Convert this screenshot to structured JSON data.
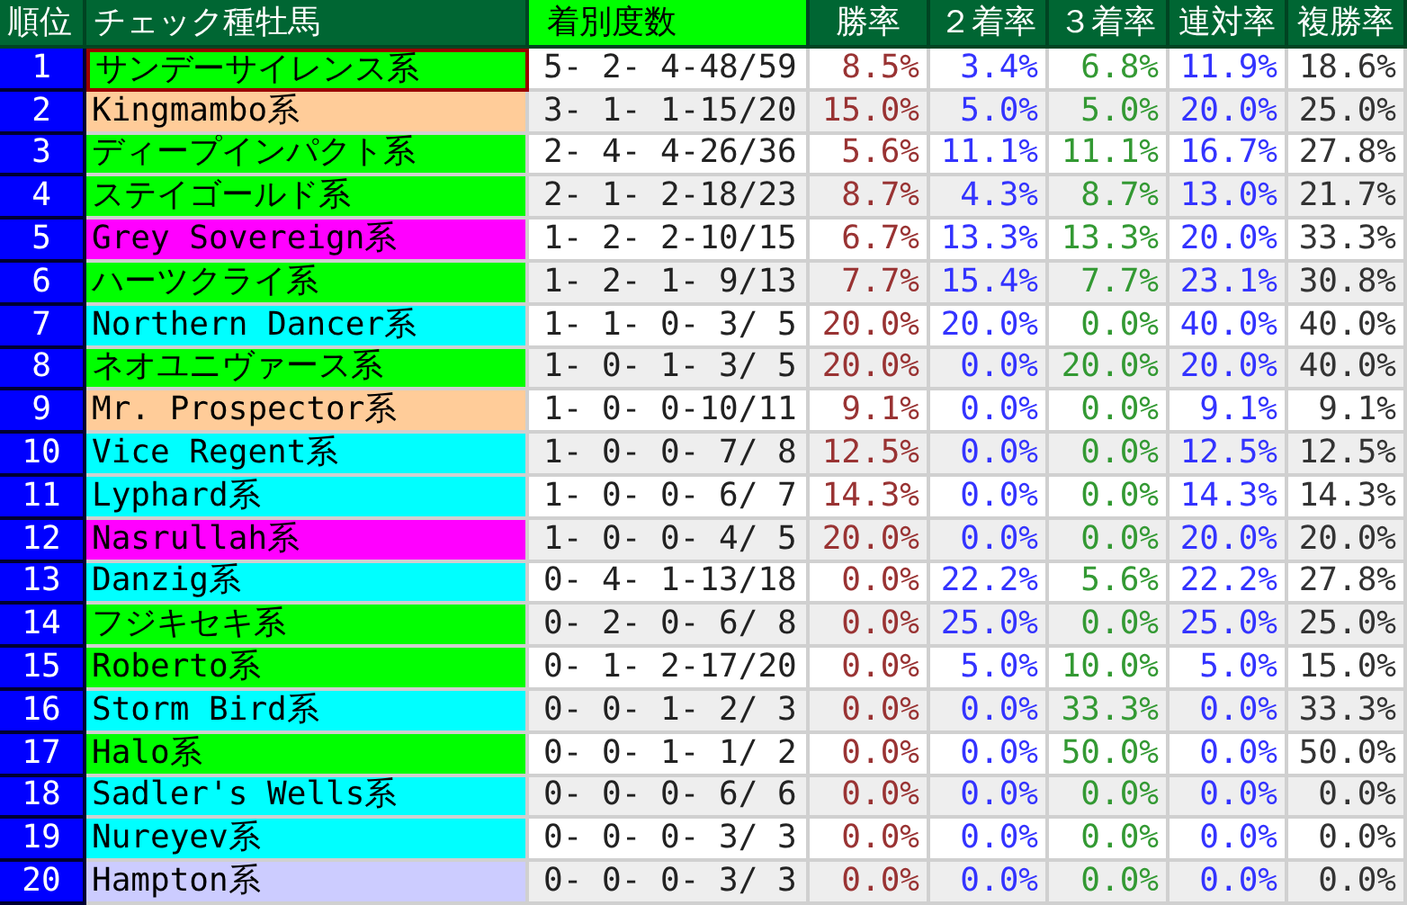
{
  "table": {
    "columns": [
      {
        "label": "順位",
        "selected": false
      },
      {
        "label": "チェック種牡馬",
        "selected": false
      },
      {
        "label": "着別度数",
        "selected": true
      },
      {
        "label": "勝率",
        "selected": false
      },
      {
        "label": "２着率",
        "selected": false
      },
      {
        "label": "３着率",
        "selected": false
      },
      {
        "label": "連対率",
        "selected": false
      },
      {
        "label": "複勝率",
        "selected": false
      }
    ],
    "rows": [
      {
        "rank": "1",
        "name": "サンデーサイレンス系",
        "color": "#00ff00",
        "selected": true,
        "record": "5- 2- 4-48/59",
        "win": "8.5%",
        "second": "3.4%",
        "third": "6.8%",
        "rentai": "11.9%",
        "fukusho": "18.6%"
      },
      {
        "rank": "2",
        "name": "Kingmambo系",
        "color": "#ffcc99",
        "selected": false,
        "record": "3- 1- 1-15/20",
        "win": "15.0%",
        "second": "5.0%",
        "third": "5.0%",
        "rentai": "20.0%",
        "fukusho": "25.0%"
      },
      {
        "rank": "3",
        "name": "ディープインパクト系",
        "color": "#00ff00",
        "selected": false,
        "record": "2- 4- 4-26/36",
        "win": "5.6%",
        "second": "11.1%",
        "third": "11.1%",
        "rentai": "16.7%",
        "fukusho": "27.8%"
      },
      {
        "rank": "4",
        "name": "ステイゴールド系",
        "color": "#00ff00",
        "selected": false,
        "record": "2- 1- 2-18/23",
        "win": "8.7%",
        "second": "4.3%",
        "third": "8.7%",
        "rentai": "13.0%",
        "fukusho": "21.7%"
      },
      {
        "rank": "5",
        "name": "Grey Sovereign系",
        "color": "#ff00ff",
        "selected": false,
        "record": "1- 2- 2-10/15",
        "win": "6.7%",
        "second": "13.3%",
        "third": "13.3%",
        "rentai": "20.0%",
        "fukusho": "33.3%"
      },
      {
        "rank": "6",
        "name": "ハーツクライ系",
        "color": "#00ff00",
        "selected": false,
        "record": "1- 2- 1- 9/13",
        "win": "7.7%",
        "second": "15.4%",
        "third": "7.7%",
        "rentai": "23.1%",
        "fukusho": "30.8%"
      },
      {
        "rank": "7",
        "name": "Northern Dancer系",
        "color": "#00ffff",
        "selected": false,
        "record": "1- 1- 0- 3/ 5",
        "win": "20.0%",
        "second": "20.0%",
        "third": "0.0%",
        "rentai": "40.0%",
        "fukusho": "40.0%"
      },
      {
        "rank": "8",
        "name": "ネオユニヴァース系",
        "color": "#00ff00",
        "selected": false,
        "record": "1- 0- 1- 3/ 5",
        "win": "20.0%",
        "second": "0.0%",
        "third": "20.0%",
        "rentai": "20.0%",
        "fukusho": "40.0%"
      },
      {
        "rank": "9",
        "name": "Mr. Prospector系",
        "color": "#ffcc99",
        "selected": false,
        "record": "1- 0- 0-10/11",
        "win": "9.1%",
        "second": "0.0%",
        "third": "0.0%",
        "rentai": "9.1%",
        "fukusho": "9.1%"
      },
      {
        "rank": "10",
        "name": "Vice Regent系",
        "color": "#00ffff",
        "selected": false,
        "record": "1- 0- 0- 7/ 8",
        "win": "12.5%",
        "second": "0.0%",
        "third": "0.0%",
        "rentai": "12.5%",
        "fukusho": "12.5%"
      },
      {
        "rank": "11",
        "name": "Lyphard系",
        "color": "#00ffff",
        "selected": false,
        "record": "1- 0- 0- 6/ 7",
        "win": "14.3%",
        "second": "0.0%",
        "third": "0.0%",
        "rentai": "14.3%",
        "fukusho": "14.3%"
      },
      {
        "rank": "12",
        "name": "Nasrullah系",
        "color": "#ff00ff",
        "selected": false,
        "record": "1- 0- 0- 4/ 5",
        "win": "20.0%",
        "second": "0.0%",
        "third": "0.0%",
        "rentai": "20.0%",
        "fukusho": "20.0%"
      },
      {
        "rank": "13",
        "name": "Danzig系",
        "color": "#00ffff",
        "selected": false,
        "record": "0- 4- 1-13/18",
        "win": "0.0%",
        "second": "22.2%",
        "third": "5.6%",
        "rentai": "22.2%",
        "fukusho": "27.8%"
      },
      {
        "rank": "14",
        "name": "フジキセキ系",
        "color": "#00ff00",
        "selected": false,
        "record": "0- 2- 0- 6/ 8",
        "win": "0.0%",
        "second": "25.0%",
        "third": "0.0%",
        "rentai": "25.0%",
        "fukusho": "25.0%"
      },
      {
        "rank": "15",
        "name": "Roberto系",
        "color": "#00ff00",
        "selected": false,
        "record": "0- 1- 2-17/20",
        "win": "0.0%",
        "second": "5.0%",
        "third": "10.0%",
        "rentai": "5.0%",
        "fukusho": "15.0%"
      },
      {
        "rank": "16",
        "name": "Storm Bird系",
        "color": "#00ffff",
        "selected": false,
        "record": "0- 0- 1- 2/ 3",
        "win": "0.0%",
        "second": "0.0%",
        "third": "33.3%",
        "rentai": "0.0%",
        "fukusho": "33.3%"
      },
      {
        "rank": "17",
        "name": "Halo系",
        "color": "#00ff00",
        "selected": false,
        "record": "0- 0- 1- 1/ 2",
        "win": "0.0%",
        "second": "0.0%",
        "third": "50.0%",
        "rentai": "0.0%",
        "fukusho": "50.0%"
      },
      {
        "rank": "18",
        "name": "Sadler's Wells系",
        "color": "#00ffff",
        "selected": false,
        "record": "0- 0- 0- 6/ 6",
        "win": "0.0%",
        "second": "0.0%",
        "third": "0.0%",
        "rentai": "0.0%",
        "fukusho": "0.0%"
      },
      {
        "rank": "19",
        "name": "Nureyev系",
        "color": "#00ffff",
        "selected": false,
        "record": "0- 0- 0- 3/ 3",
        "win": "0.0%",
        "second": "0.0%",
        "third": "0.0%",
        "rentai": "0.0%",
        "fukusho": "0.0%"
      },
      {
        "rank": "20",
        "name": "Hampton系",
        "color": "#ccccff",
        "selected": false,
        "record": "0- 0- 0- 3/ 3",
        "win": "0.0%",
        "second": "0.0%",
        "third": "0.0%",
        "rentai": "0.0%",
        "fukusho": "0.0%"
      }
    ]
  }
}
